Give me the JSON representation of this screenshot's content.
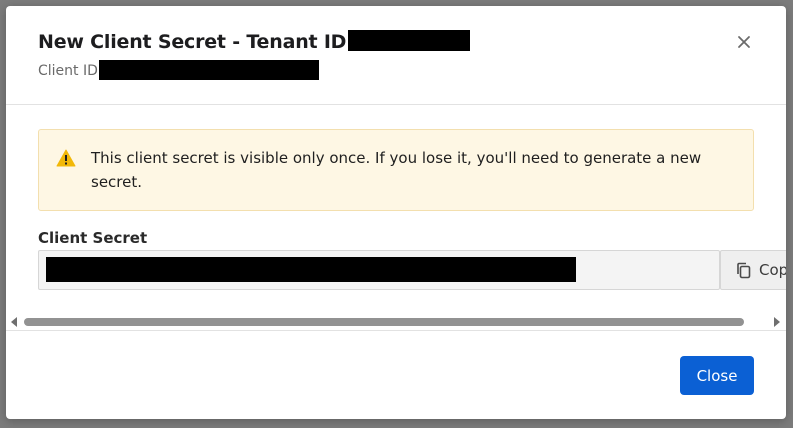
{
  "modal": {
    "title": "New Client Secret - Tenant ID",
    "subtitle": "Client ID"
  },
  "alert": {
    "icon": "warning-icon",
    "message": "This client secret is visible only once. If you lose it, you'll need to generate a new secret."
  },
  "secret": {
    "label": "Client Secret",
    "copy_label": "Copy"
  },
  "footer": {
    "close_label": "Close"
  },
  "colors": {
    "primary": "#0b60d4",
    "warning": "#f2b807",
    "alert_bg": "#fef7e4"
  }
}
